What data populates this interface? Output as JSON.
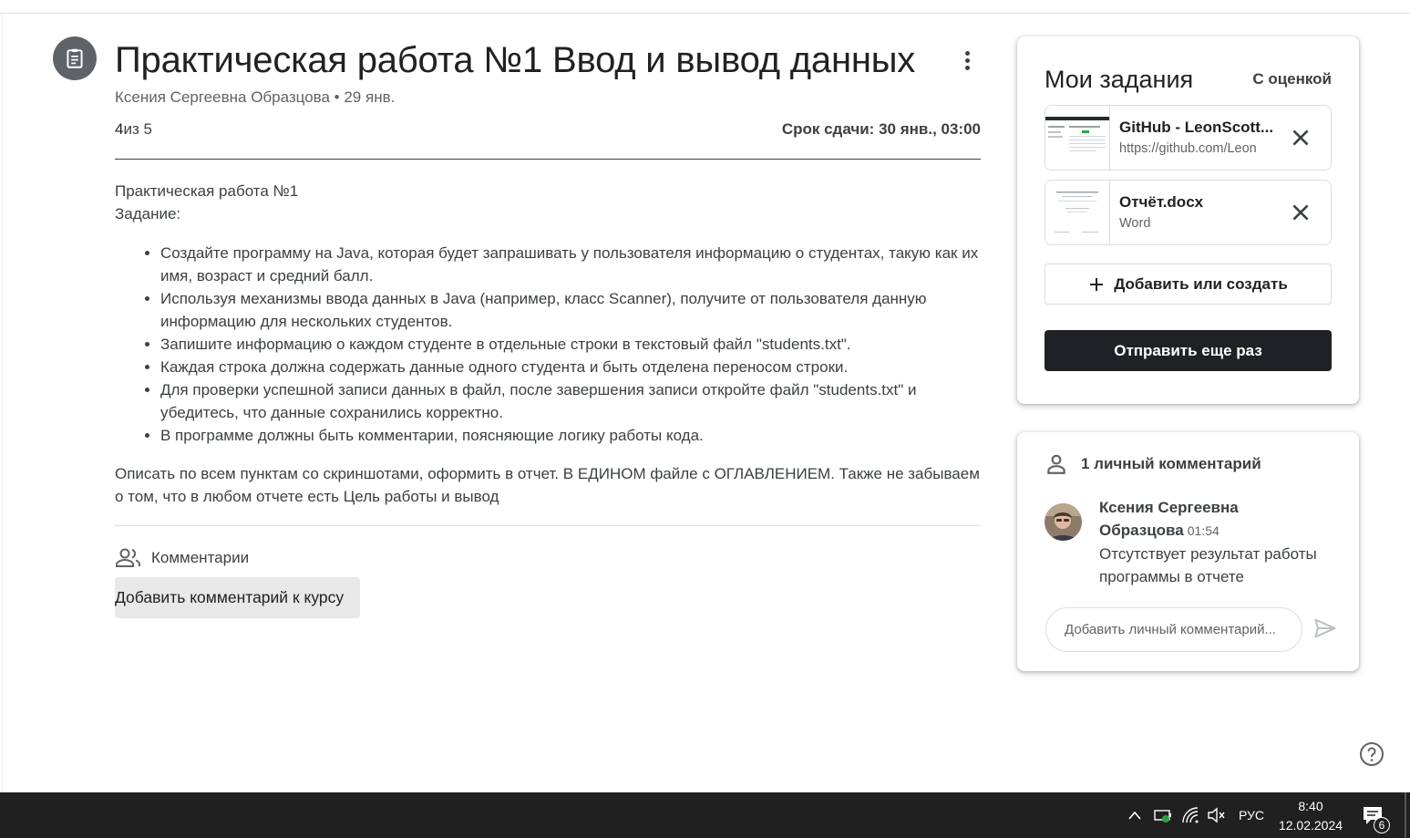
{
  "assignment": {
    "title": "Практическая работа №1 Ввод и вывод данных",
    "meta": "Ксения Сергеевна Образцова • 29 янв.",
    "points_value": "4",
    "points_rest": "из 5",
    "due": "Срок сдачи: 30 янв., 03:00",
    "description": {
      "line1": "Практическая работа №1",
      "line2": "Задание:",
      "bullets": [
        "Создайте программу на Java, которая будет запрашивать у пользователя информацию о студентах, такую как их имя, возраст и средний балл.",
        "Используя механизмы ввода данных в Java (например, класс Scanner), получите от пользователя данную информацию для нескольких студентов.",
        "Запишите информацию о каждом студенте в отдельные строки в текстовый файл \"students.txt\".",
        "Каждая строка должна содержать данные одного студента и быть отделена переносом строки.",
        "Для проверки успешной записи данных в файл, после завершения записи откройте файл \"students.txt\" и убедитесь, что данные сохранились корректно.",
        "В программе должны быть комментарии, поясняющие логику работы кода."
      ],
      "footer": "Описать по всем пунктам со скриншотами, оформить в отчет. В ЕДИНОМ файле с ОГЛАВЛЕНИЕМ. Также не забываем о том, что в любом отчете есть Цель работы и вывод"
    },
    "comments_label": "Комментарии",
    "add_course_comment": "Добавить комментарий к курсу"
  },
  "my_work": {
    "title": "Мои задания",
    "status": "С оценкой",
    "attachments": [
      {
        "name": "GitHub - LeonScott...",
        "subtitle": "https://github.com/Leon"
      },
      {
        "name": "Отчёт.docx",
        "subtitle": "Word"
      }
    ],
    "add_or_create": "Добавить или создать",
    "resubmit": "Отправить еще раз"
  },
  "private_comments": {
    "header": "1 личный комментарий",
    "comment": {
      "author": "Ксения Сергеевна Образцова",
      "time": "01:54",
      "text": "Отсутствует результат работы программы в отчете"
    },
    "input_placeholder": "Добавить личный комментарий..."
  },
  "taskbar": {
    "language": "РУС",
    "time": "8:40",
    "date": "12.02.2024",
    "notification_count": "6"
  }
}
